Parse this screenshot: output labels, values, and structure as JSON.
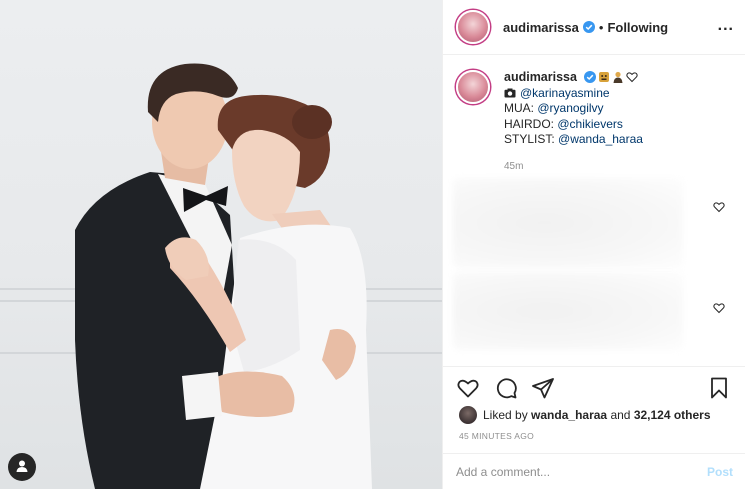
{
  "post": {
    "photo_icon": "person-silhouette-icon"
  },
  "header": {
    "username": "audimarissa",
    "dot": "•",
    "follow_status": "Following",
    "more": "..."
  },
  "caption": {
    "username": "audimarissa",
    "emojis": [
      "verified-badge",
      "gorilla-emoji",
      "person-emoji",
      "heart-outline-emoji"
    ],
    "photo_credit": "@karinayasmine",
    "mua_label": "MUA:",
    "mua_handle": "@ryanogilvy",
    "hairdo_label": "HAIRDO:",
    "hairdo_handle": "@chikievers",
    "stylist_label": "STYLIST:",
    "stylist_handle": "@wanda_haraa",
    "time": "45m"
  },
  "likes": {
    "prefix": "Liked by",
    "user": "wanda_haraa",
    "joiner": "and",
    "count": "32,124 others"
  },
  "timestamp": "45 MINUTES AGO",
  "comment_box": {
    "placeholder": "Add a comment...",
    "post_label": "Post"
  },
  "colors": {
    "mention": "#00376b",
    "verified": "#3897f0",
    "post_disabled": "#b2dffc",
    "muted": "#8e8e8e"
  }
}
